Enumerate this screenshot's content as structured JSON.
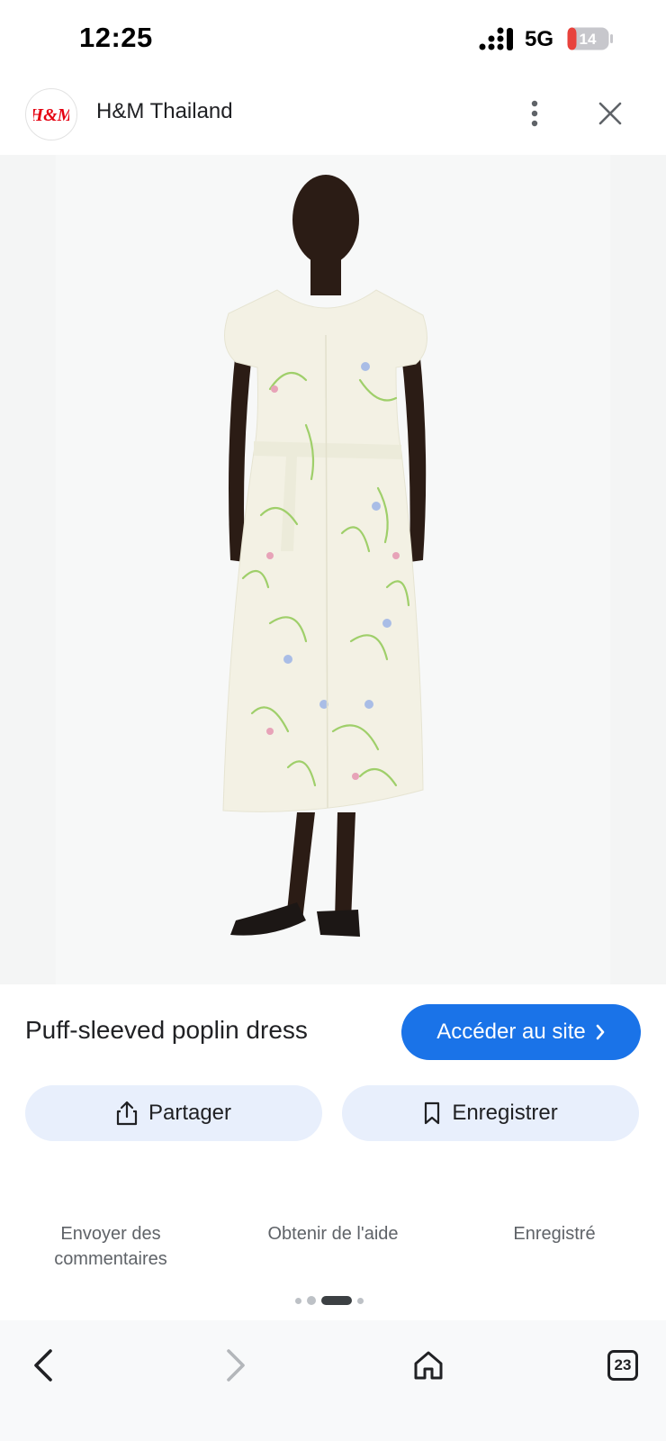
{
  "status_bar": {
    "time": "12:25",
    "network": "5G",
    "battery": "14",
    "battery_color": "#e8423c"
  },
  "header": {
    "logo_text": "H&M",
    "logo_color": "#e50010",
    "site_name": "H&M Thailand",
    "more_icon": "more-vert-icon",
    "close_icon": "close-icon"
  },
  "product": {
    "title": "Puff-sleeved poplin dress",
    "visit_label": "Accéder au site",
    "visit_icon": "chevron-right-icon",
    "accent_color": "#1a73e8"
  },
  "actions": {
    "share_label": "Partager",
    "share_icon": "share-icon",
    "save_label": "Enregistrer",
    "save_icon": "bookmark-icon"
  },
  "footer": {
    "feedback_line1": "Envoyer des",
    "feedback_line2": "commentaires",
    "help": "Obtenir de l'aide",
    "saved": "Enregistré"
  },
  "pagination": {
    "count": 4,
    "active_index": 2
  },
  "bottom_nav": {
    "back_icon": "back-icon",
    "forward_icon": "forward-icon",
    "home_icon": "home-icon",
    "tab_count": "23"
  }
}
